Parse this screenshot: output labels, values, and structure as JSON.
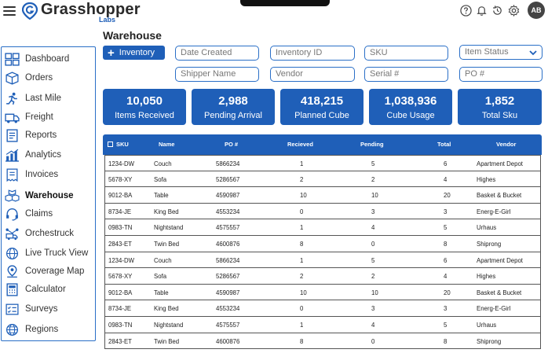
{
  "header": {
    "brand_name": "Grasshopper",
    "brand_sub": "Labs",
    "avatar_initials": "AB",
    "icons": [
      "menu-icon",
      "help-icon",
      "bell-icon",
      "history-icon",
      "gear-icon"
    ]
  },
  "sidebar": {
    "items": [
      {
        "label": "Dashboard",
        "icon": "dashboard-icon"
      },
      {
        "label": "Orders",
        "icon": "box-icon"
      },
      {
        "label": "Last Mile",
        "icon": "runner-icon"
      },
      {
        "label": "Freight",
        "icon": "truck-icon"
      },
      {
        "label": "Reports",
        "icon": "report-icon"
      },
      {
        "label": "Analytics",
        "icon": "chart-icon"
      },
      {
        "label": "Invoices",
        "icon": "invoice-icon"
      },
      {
        "label": "Warehouse",
        "icon": "boxes-icon",
        "active": true
      },
      {
        "label": "Claims",
        "icon": "headset-icon"
      },
      {
        "label": "Orchestruck",
        "icon": "truck-network-icon"
      },
      {
        "label": "Live Truck View",
        "icon": "globe-icon"
      },
      {
        "label": "Coverage Map",
        "icon": "map-pin-icon"
      },
      {
        "label": "Calculator",
        "icon": "calculator-icon"
      },
      {
        "label": "Surveys",
        "icon": "survey-icon"
      },
      {
        "label": "Regions",
        "icon": "globe-icon"
      }
    ]
  },
  "main": {
    "title": "Warehouse",
    "add_button": "Inventory",
    "filters": {
      "date_created": "Date Created",
      "inventory_id": "Inventory ID",
      "sku": "SKU",
      "item_status": "Item Status",
      "shipper_name": "Shipper Name",
      "vendor": "Vendor",
      "serial": "Serial #",
      "po": "PO #"
    },
    "stats": [
      {
        "value": "10,050",
        "label": "Items Received"
      },
      {
        "value": "2,988",
        "label": "Pending Arrival"
      },
      {
        "value": "418,215",
        "label": "Planned Cube"
      },
      {
        "value": "1,038,936",
        "label": "Cube Usage"
      },
      {
        "value": "1,852",
        "label": "Total Sku"
      }
    ],
    "table": {
      "columns": [
        "SKU",
        "Name",
        "PO #",
        "Recieved",
        "Pending",
        "Total",
        "Vendor"
      ],
      "rows": [
        [
          "1234-DW",
          "Couch",
          "5866234",
          "1",
          "5",
          "6",
          "Apartment Depot"
        ],
        [
          "5678-XY",
          "Sofa",
          "5286567",
          "2",
          "2",
          "4",
          "Highes"
        ],
        [
          "9012-BA",
          "Table",
          "4590987",
          "10",
          "10",
          "20",
          "Basket & Bucket"
        ],
        [
          "8734-JE",
          "King Bed",
          "4553234",
          "0",
          "3",
          "3",
          "Energ-E-Girl"
        ],
        [
          "0983-TN",
          "Nightstand",
          "4575557",
          "1",
          "4",
          "5",
          "Urhaus"
        ],
        [
          "2843-ET",
          "Twin Bed",
          "4600876",
          "8",
          "0",
          "8",
          "Shiprong"
        ],
        [
          "1234-DW",
          "Couch",
          "5866234",
          "1",
          "5",
          "6",
          "Apartment Depot"
        ],
        [
          "5678-XY",
          "Sofa",
          "5286567",
          "2",
          "2",
          "4",
          "Highes"
        ],
        [
          "9012-BA",
          "Table",
          "4590987",
          "10",
          "10",
          "20",
          "Basket & Bucket"
        ],
        [
          "8734-JE",
          "King Bed",
          "4553234",
          "0",
          "3",
          "3",
          "Energ-E-Girl"
        ],
        [
          "0983-TN",
          "Nightstand",
          "4575557",
          "1",
          "4",
          "5",
          "Urhaus"
        ],
        [
          "2843-ET",
          "Twin Bed",
          "4600876",
          "8",
          "0",
          "8",
          "Shiprong"
        ]
      ]
    }
  },
  "colors": {
    "accent": "#1f5fb8",
    "border": "#2a6fc7"
  }
}
